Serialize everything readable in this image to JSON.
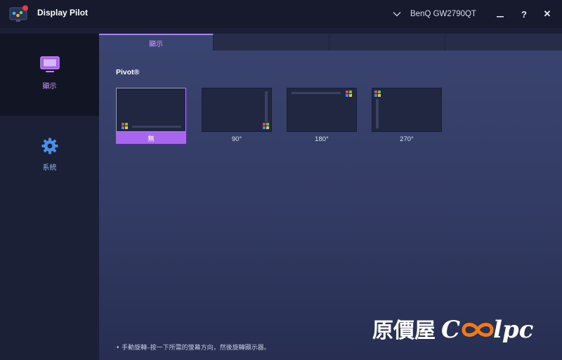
{
  "titlebar": {
    "app_title": "Display Pilot",
    "monitor_name": "BenQ GW2790QT",
    "help_label": "?",
    "close_label": "✕"
  },
  "sidebar": {
    "items": [
      {
        "label": "顯示",
        "icon": "monitor-icon",
        "active": true
      },
      {
        "label": "系統",
        "icon": "gear-icon",
        "active": false
      }
    ]
  },
  "tabs": [
    {
      "label": "顯示",
      "active": true
    },
    {
      "label": ""
    },
    {
      "label": ""
    },
    {
      "label": ""
    }
  ],
  "pivot": {
    "title": "Pivot®",
    "options": [
      {
        "label": "無",
        "selected": true
      },
      {
        "label": "90°",
        "selected": false
      },
      {
        "label": "180°",
        "selected": false
      },
      {
        "label": "270°",
        "selected": false
      }
    ]
  },
  "hint": "•  手動旋轉–按一下所需的螢幕方向，然後旋轉顯示器。",
  "watermark": {
    "text_prefix": "原價屋",
    "text_suffix": "lpc",
    "brand_color": "#f07a1a"
  },
  "colors": {
    "accent": "#a866ee",
    "accent_text": "#c79bff"
  }
}
